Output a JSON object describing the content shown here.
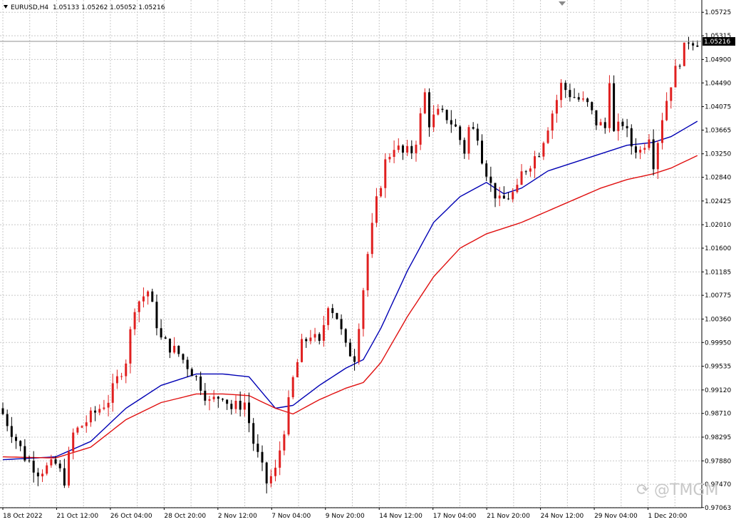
{
  "header": {
    "symbol": "EURUSD,H4",
    "values": "1.05133 1.05262 1.05052 1.05216"
  },
  "watermark": "@TMGM",
  "colors": {
    "bull": "#e02020",
    "bear": "#000000",
    "ma_fast": "#0000b4",
    "ma_slow": "#e01010",
    "grid": "#c8c8c8",
    "price_line": "#909090"
  },
  "chart_data": {
    "type": "candlestick",
    "title": "EURUSD,H4",
    "ohlc_readout": [
      1.05133,
      1.05262,
      1.05052,
      1.05216
    ],
    "current_price": "1.05216",
    "ylim": [
      0.9706,
      1.0594
    ],
    "y_ticks": [
      "1.05725",
      "1.05315",
      "1.04900",
      "1.04490",
      "1.04075",
      "1.03665",
      "1.03250",
      "1.02840",
      "1.02425",
      "1.02010",
      "1.01600",
      "1.01185",
      "1.00775",
      "1.00360",
      "0.99950",
      "0.99535",
      "0.99120",
      "0.98710",
      "0.98295",
      "0.97880",
      "0.97470",
      "0.97063"
    ],
    "x_ticks": [
      "18 Oct 2022",
      "21 Oct 12:00",
      "26 Oct 04:00",
      "28 Oct 20:00",
      "2 Nov 12:00",
      "7 Nov 04:00",
      "9 Nov 20:00",
      "14 Nov 12:00",
      "17 Nov 04:00",
      "21 Nov 20:00",
      "24 Nov 12:00",
      "29 Nov 04:00",
      "1 Dec 20:00"
    ],
    "bars": 128,
    "close_path": [
      [
        0,
        0.987
      ],
      [
        5,
        0.9795
      ],
      [
        8,
        0.977
      ],
      [
        12,
        0.9782
      ],
      [
        14,
        0.9755
      ],
      [
        16,
        0.9835
      ],
      [
        20,
        0.9865
      ],
      [
        24,
        0.9895
      ],
      [
        28,
        0.9965
      ],
      [
        30,
        1.006
      ],
      [
        33,
        1.0085
      ],
      [
        36,
        1.0
      ],
      [
        40,
        0.9975
      ],
      [
        43,
        0.9945
      ],
      [
        45,
        0.992
      ],
      [
        47,
        0.989
      ],
      [
        50,
        0.9905
      ],
      [
        52,
        0.988
      ],
      [
        55,
        0.989
      ],
      [
        57,
        0.982
      ],
      [
        60,
        0.975
      ],
      [
        62,
        0.977
      ],
      [
        64,
        0.9845
      ],
      [
        66,
        0.993
      ],
      [
        68,
        0.999
      ],
      [
        70,
        1.001
      ],
      [
        72,
        0.999
      ],
      [
        74,
        1.0065
      ],
      [
        76,
        1.004
      ],
      [
        78,
        0.9985
      ],
      [
        80,
        0.997
      ],
      [
        82,
        1.009
      ],
      [
        83,
        1.015
      ],
      [
        85,
        1.024
      ],
      [
        87,
        1.031
      ],
      [
        89,
        1.034
      ],
      [
        91,
        1.0325
      ],
      [
        93,
        1.033
      ],
      [
        94,
        1.035
      ],
      [
        96,
        1.043
      ],
      [
        97,
        1.038
      ],
      [
        99,
        1.0395
      ],
      [
        101,
        1.039
      ],
      [
        103,
        1.037
      ],
      [
        105,
        1.033
      ],
      [
        106,
        1.037
      ],
      [
        108,
        1.036
      ],
      [
        109,
        1.032
      ],
      [
        111,
        1.027
      ],
      [
        113,
        1.024
      ],
      [
        115,
        1.025
      ],
      [
        117,
        1.026
      ],
      [
        118,
        1.029
      ],
      [
        120,
        1.031
      ],
      [
        122,
        1.033
      ],
      [
        124,
        1.0375
      ],
      [
        126,
        1.042
      ],
      [
        127,
        1.0445
      ],
      [
        129,
        1.043
      ],
      [
        131,
        1.042
      ],
      [
        133,
        1.041
      ],
      [
        135,
        1.038
      ],
      [
        137,
        1.037
      ],
      [
        138,
        1.046
      ],
      [
        139,
        1.036
      ],
      [
        141,
        1.038
      ],
      [
        143,
        1.034
      ],
      [
        145,
        1.033
      ],
      [
        147,
        1.036
      ],
      [
        148,
        1.031
      ],
      [
        150,
        1.039
      ],
      [
        152,
        1.045
      ],
      [
        154,
        1.049
      ],
      [
        156,
        1.0525
      ],
      [
        158,
        1.0522
      ]
    ],
    "series": [
      {
        "values_start": 0.979,
        "values": [
          [
            0,
            0.979
          ],
          [
            12,
            0.9795
          ],
          [
            20,
            0.9822
          ],
          [
            28,
            0.988
          ],
          [
            36,
            0.992
          ],
          [
            44,
            0.994
          ],
          [
            50,
            0.994
          ],
          [
            56,
            0.9935
          ],
          [
            62,
            0.988
          ],
          [
            66,
            0.9885
          ],
          [
            72,
            0.992
          ],
          [
            78,
            0.995
          ],
          [
            82,
            0.9965
          ],
          [
            86,
            1.002
          ],
          [
            92,
            1.012
          ],
          [
            98,
            1.0205
          ],
          [
            104,
            1.025
          ],
          [
            110,
            1.0275
          ],
          [
            114,
            1.0255
          ],
          [
            118,
            1.0265
          ],
          [
            124,
            1.0295
          ],
          [
            130,
            1.031
          ],
          [
            136,
            1.0325
          ],
          [
            142,
            1.034
          ],
          [
            148,
            1.0345
          ],
          [
            152,
            1.0355
          ],
          [
            158,
            1.0382
          ]
        ]
      },
      {
        "values_start": 0.9795,
        "values": [
          [
            0,
            0.9795
          ],
          [
            12,
            0.9793
          ],
          [
            20,
            0.9812
          ],
          [
            28,
            0.986
          ],
          [
            36,
            0.989
          ],
          [
            44,
            0.9905
          ],
          [
            50,
            0.9905
          ],
          [
            56,
            0.9902
          ],
          [
            62,
            0.988
          ],
          [
            66,
            0.987
          ],
          [
            72,
            0.9895
          ],
          [
            78,
            0.9915
          ],
          [
            82,
            0.9925
          ],
          [
            86,
            0.996
          ],
          [
            92,
            1.004
          ],
          [
            98,
            1.011
          ],
          [
            104,
            1.016
          ],
          [
            110,
            1.0185
          ],
          [
            114,
            1.0195
          ],
          [
            118,
            1.0205
          ],
          [
            124,
            1.0225
          ],
          [
            130,
            1.0245
          ],
          [
            136,
            1.0265
          ],
          [
            142,
            1.028
          ],
          [
            148,
            1.029
          ],
          [
            152,
            1.03
          ],
          [
            158,
            1.0322
          ]
        ]
      }
    ]
  }
}
